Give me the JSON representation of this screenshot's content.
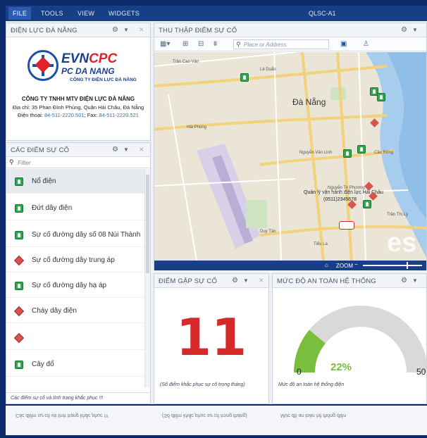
{
  "menubar": {
    "items": [
      "FILE",
      "TOOLS",
      "VIEW",
      "WIDGETS"
    ],
    "title": "QLSC-A1"
  },
  "logo_panel": {
    "title": "ĐIỆN LỰC ĐÀ NẴNG",
    "evn": "EVN",
    "cpc": "CPC",
    "pc_name": "PC DA NANG",
    "subsidiary": "CÔNG TY ĐIỆN LỰC ĐÀ NẴNG",
    "company_name": "CÔNG TY TNHH MTV ĐIỆN LỰC ĐÀ NẴNG",
    "address": "Địa chỉ: 35 Phan Đình Phùng, Quận Hải Châu, Đà Nẵng",
    "phone_label": "Điện thoại:",
    "phone": "84-511-2220.501",
    "fax_label": "; Fax:",
    "fax": "84-511-2220.521"
  },
  "incidents_panel": {
    "title": "CÁC ĐIỂM SỰ CỐ",
    "filter_placeholder": "Filter",
    "items": [
      {
        "label": "Nổ điện",
        "icon": "green-square"
      },
      {
        "label": "Đứt dây điện",
        "icon": "green-square"
      },
      {
        "label": "Sự cố đường dây số 08 Núi Thành",
        "icon": "green-square"
      },
      {
        "label": "Sự cố đường dây trung áp",
        "icon": "red-diamond"
      },
      {
        "label": "Sự cố đường dây hạ áp",
        "icon": "green-square"
      },
      {
        "label": "Cháy dây điện",
        "icon": "red-diamond"
      },
      {
        "label": "",
        "icon": "red-diamond"
      },
      {
        "label": "Cây đổ",
        "icon": "green-square"
      }
    ],
    "footer": "Các điểm sự cố và tình trạng khắc phục !!!"
  },
  "map_panel": {
    "title": "THU THẬP ĐIỂM SỰ CỐ",
    "search_placeholder": "Place or Address",
    "city_label": "Đà Nẵng",
    "street_labels": [
      "Trần Cao Vân",
      "Lê Duẩn",
      "Nguyễn Văn Linh",
      "Duy Tân",
      "Hải Phòng",
      "Cầu Rồng",
      "Trần Thị Lý",
      "Nguyễn Tri Phương",
      "Tiểu La"
    ],
    "popup_label": "Quản lý vận hành điện lực Hải Châu",
    "popup_phone": "(0511)2345678",
    "watermark": "es",
    "zoom_label": "ZOOM"
  },
  "kpi_panel": {
    "title": "ĐIỂM GẶP SỰ CỐ",
    "value": "11",
    "footer": "(Số điểm khắc phục sự cố trong tháng)"
  },
  "safety_panel": {
    "title": "MỨC ĐỘ AN TOÀN HỆ THỐNG",
    "percent_text": "22%",
    "percent_value": 22,
    "min_label": "0",
    "max_label": "50",
    "footer": "Mức độ an toàn hệ thống điện"
  },
  "reflection": {
    "texts": [
      "Các điểm sự cố và tình trạng khắc phục !!!",
      "(Số điểm khắc phục sự cố trong tháng)",
      "Mức độ an toàn hệ thống điện"
    ]
  },
  "colors": {
    "frame": "#0b2a6b",
    "menubar": "#163f86",
    "accent_red": "#d62a2a",
    "gauge_green": "#7bbd3c",
    "gauge_gray": "#d9d9d9",
    "incident_green": "#2fa84f",
    "incident_red": "#d9534f"
  }
}
